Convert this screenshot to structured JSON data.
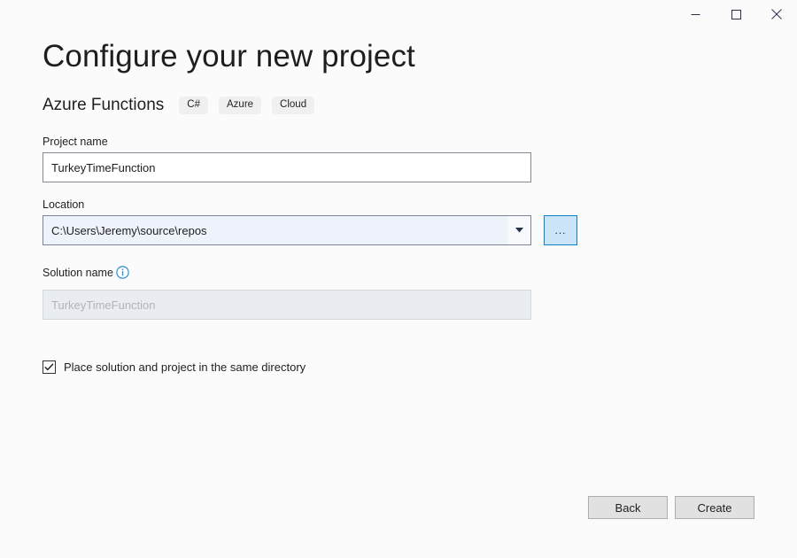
{
  "window": {
    "controls": [
      {
        "name": "minimize",
        "label": "Minimize"
      },
      {
        "name": "maximize",
        "label": "Maximize"
      },
      {
        "name": "close",
        "label": "Close"
      }
    ]
  },
  "page": {
    "title": "Configure your new project",
    "template_name": "Azure Functions",
    "tags": [
      "C#",
      "Azure",
      "Cloud"
    ]
  },
  "fields": {
    "project_name": {
      "label": "Project name",
      "value": "TurkeyTimeFunction"
    },
    "location": {
      "label": "Location",
      "value": "C:\\Users\\Jeremy\\source\\repos",
      "browse_label": "...",
      "dropdown_icon": "chevron-down-icon"
    },
    "solution_name": {
      "label": "Solution name",
      "placeholder": "TurkeyTimeFunction",
      "value": "",
      "info_icon": "info-icon",
      "disabled": true
    },
    "same_directory": {
      "label": "Place solution and project in the same directory",
      "checked": true
    }
  },
  "footer": {
    "back_label": "Back",
    "create_label": "Create"
  },
  "colors": {
    "accent": "#0078d4",
    "background": "#fbfbfb",
    "input_border": "#848a94",
    "button_face": "#e1e1e1",
    "disabled_fill": "#e9edf2",
    "titlebar_icon": "#2b3044"
  }
}
